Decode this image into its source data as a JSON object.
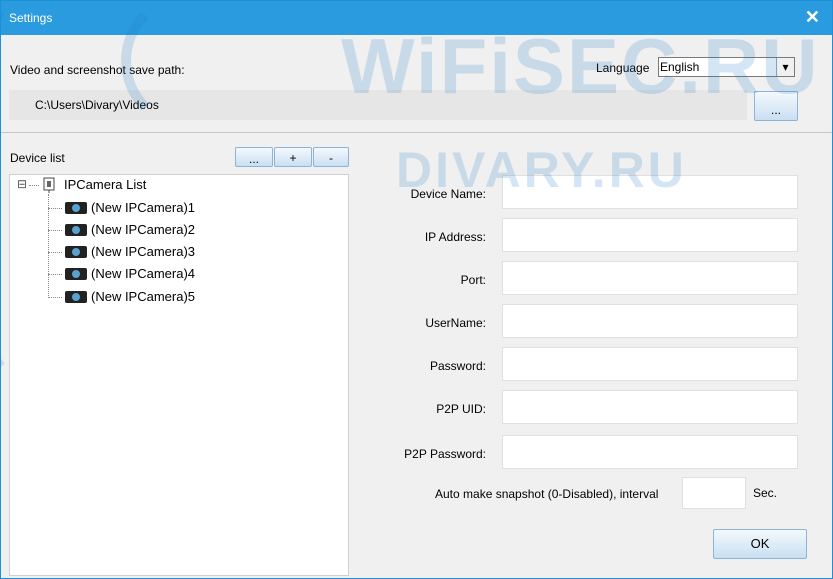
{
  "window": {
    "title": "Settings",
    "close_glyph": "✕"
  },
  "path": {
    "label": "Video and screenshot save path:",
    "value": "C:\\Users\\Divary\\Videos",
    "browse_label": "..."
  },
  "language": {
    "label": "Language",
    "selected": "English",
    "dropdown_glyph": "▾"
  },
  "device_list": {
    "label": "Device list",
    "buttons": {
      "edit": "...",
      "add": "+",
      "remove": "-"
    },
    "root": "IPCamera List",
    "expander": "⊟",
    "items": [
      "(New IPCamera)1",
      "(New IPCamera)2",
      "(New IPCamera)3",
      "(New IPCamera)4",
      "(New IPCamera)5"
    ]
  },
  "form": {
    "device_name": "Device Name:",
    "ip_address": "IP Address:",
    "port": "Port:",
    "username": "UserName:",
    "password": "Password:",
    "p2p_uid": "P2P UID:",
    "p2p_password": "P2P Password:",
    "snapshot_label": "Auto make snapshot (0-Disabled), interval",
    "snapshot_unit": "Sec.",
    "ok": "OK"
  },
  "watermark": {
    "top": "WiFiSEC.RU",
    "middle": "DIVARY.RU"
  },
  "colors": {
    "titlebar": "#2b9be0",
    "accent": "#1a77c9"
  }
}
